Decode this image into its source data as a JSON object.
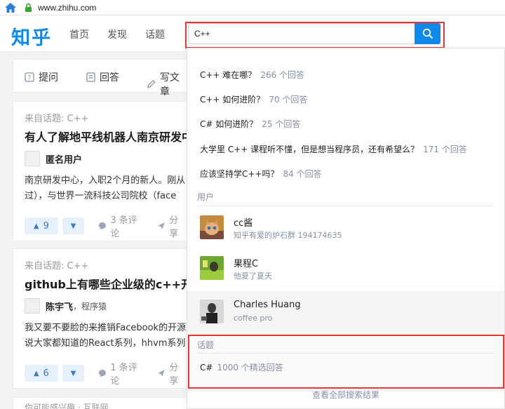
{
  "browser": {
    "url": "www.zhihu.com"
  },
  "header": {
    "logo": "知乎",
    "nav": [
      "首页",
      "发现",
      "话题"
    ],
    "search_value": "C++"
  },
  "actions": [
    "提问",
    "回答",
    "写文章"
  ],
  "feed": [
    {
      "from": "来自话题: C++",
      "title": "有人了解地平线机器人南京研发中心",
      "author": "匿名用户",
      "author_tag": "",
      "excerpt": "南京研发中心，入职2个月的新人。刚从过），与世界一流科技公司院校（face",
      "upvotes": "9",
      "comments": "3 条评论",
      "share": "分享"
    },
    {
      "from": "来自话题: C++",
      "title": "github上有哪些企业级的c++开源",
      "author": "陈宇飞",
      "author_tag": "，程序猿",
      "excerpt": "我又要不要脸的来推销Facebook的开源说大家都知道的React系列，hhvm系列",
      "upvotes": "6",
      "comments": "1 条评论",
      "share": "分享"
    }
  ],
  "feed_more": "你可能感兴趣 · 互联网",
  "dropdown": {
    "questions": [
      {
        "text": "C++ 难在哪？",
        "count": "266 个回答"
      },
      {
        "text": "C++ 如何进阶？",
        "count": "70 个回答"
      },
      {
        "text": "C# 如何进阶？",
        "count": "25 个回答"
      },
      {
        "text": "大学里 C++ 课程听不懂，但是想当程序员，还有希望么？",
        "count": "171 个回答"
      },
      {
        "text": "应该坚持学C++吗？",
        "count": "84 个回答"
      }
    ],
    "users_title": "用户",
    "users": [
      {
        "name": "cc酱",
        "desc": "知乎有爱的炉石群 194174635"
      },
      {
        "name": "果程C",
        "desc": "他夏了夏天"
      },
      {
        "name": "Charles Huang",
        "desc": "coffee pro"
      }
    ],
    "topics_title": "话题",
    "topic": {
      "name": "C#",
      "count": "1000 个精选回答"
    },
    "view_all": "查看全部搜索结果"
  },
  "colors": {
    "brand": "#0f88eb",
    "highlight": "#e33333",
    "muted": "#8590a6"
  }
}
